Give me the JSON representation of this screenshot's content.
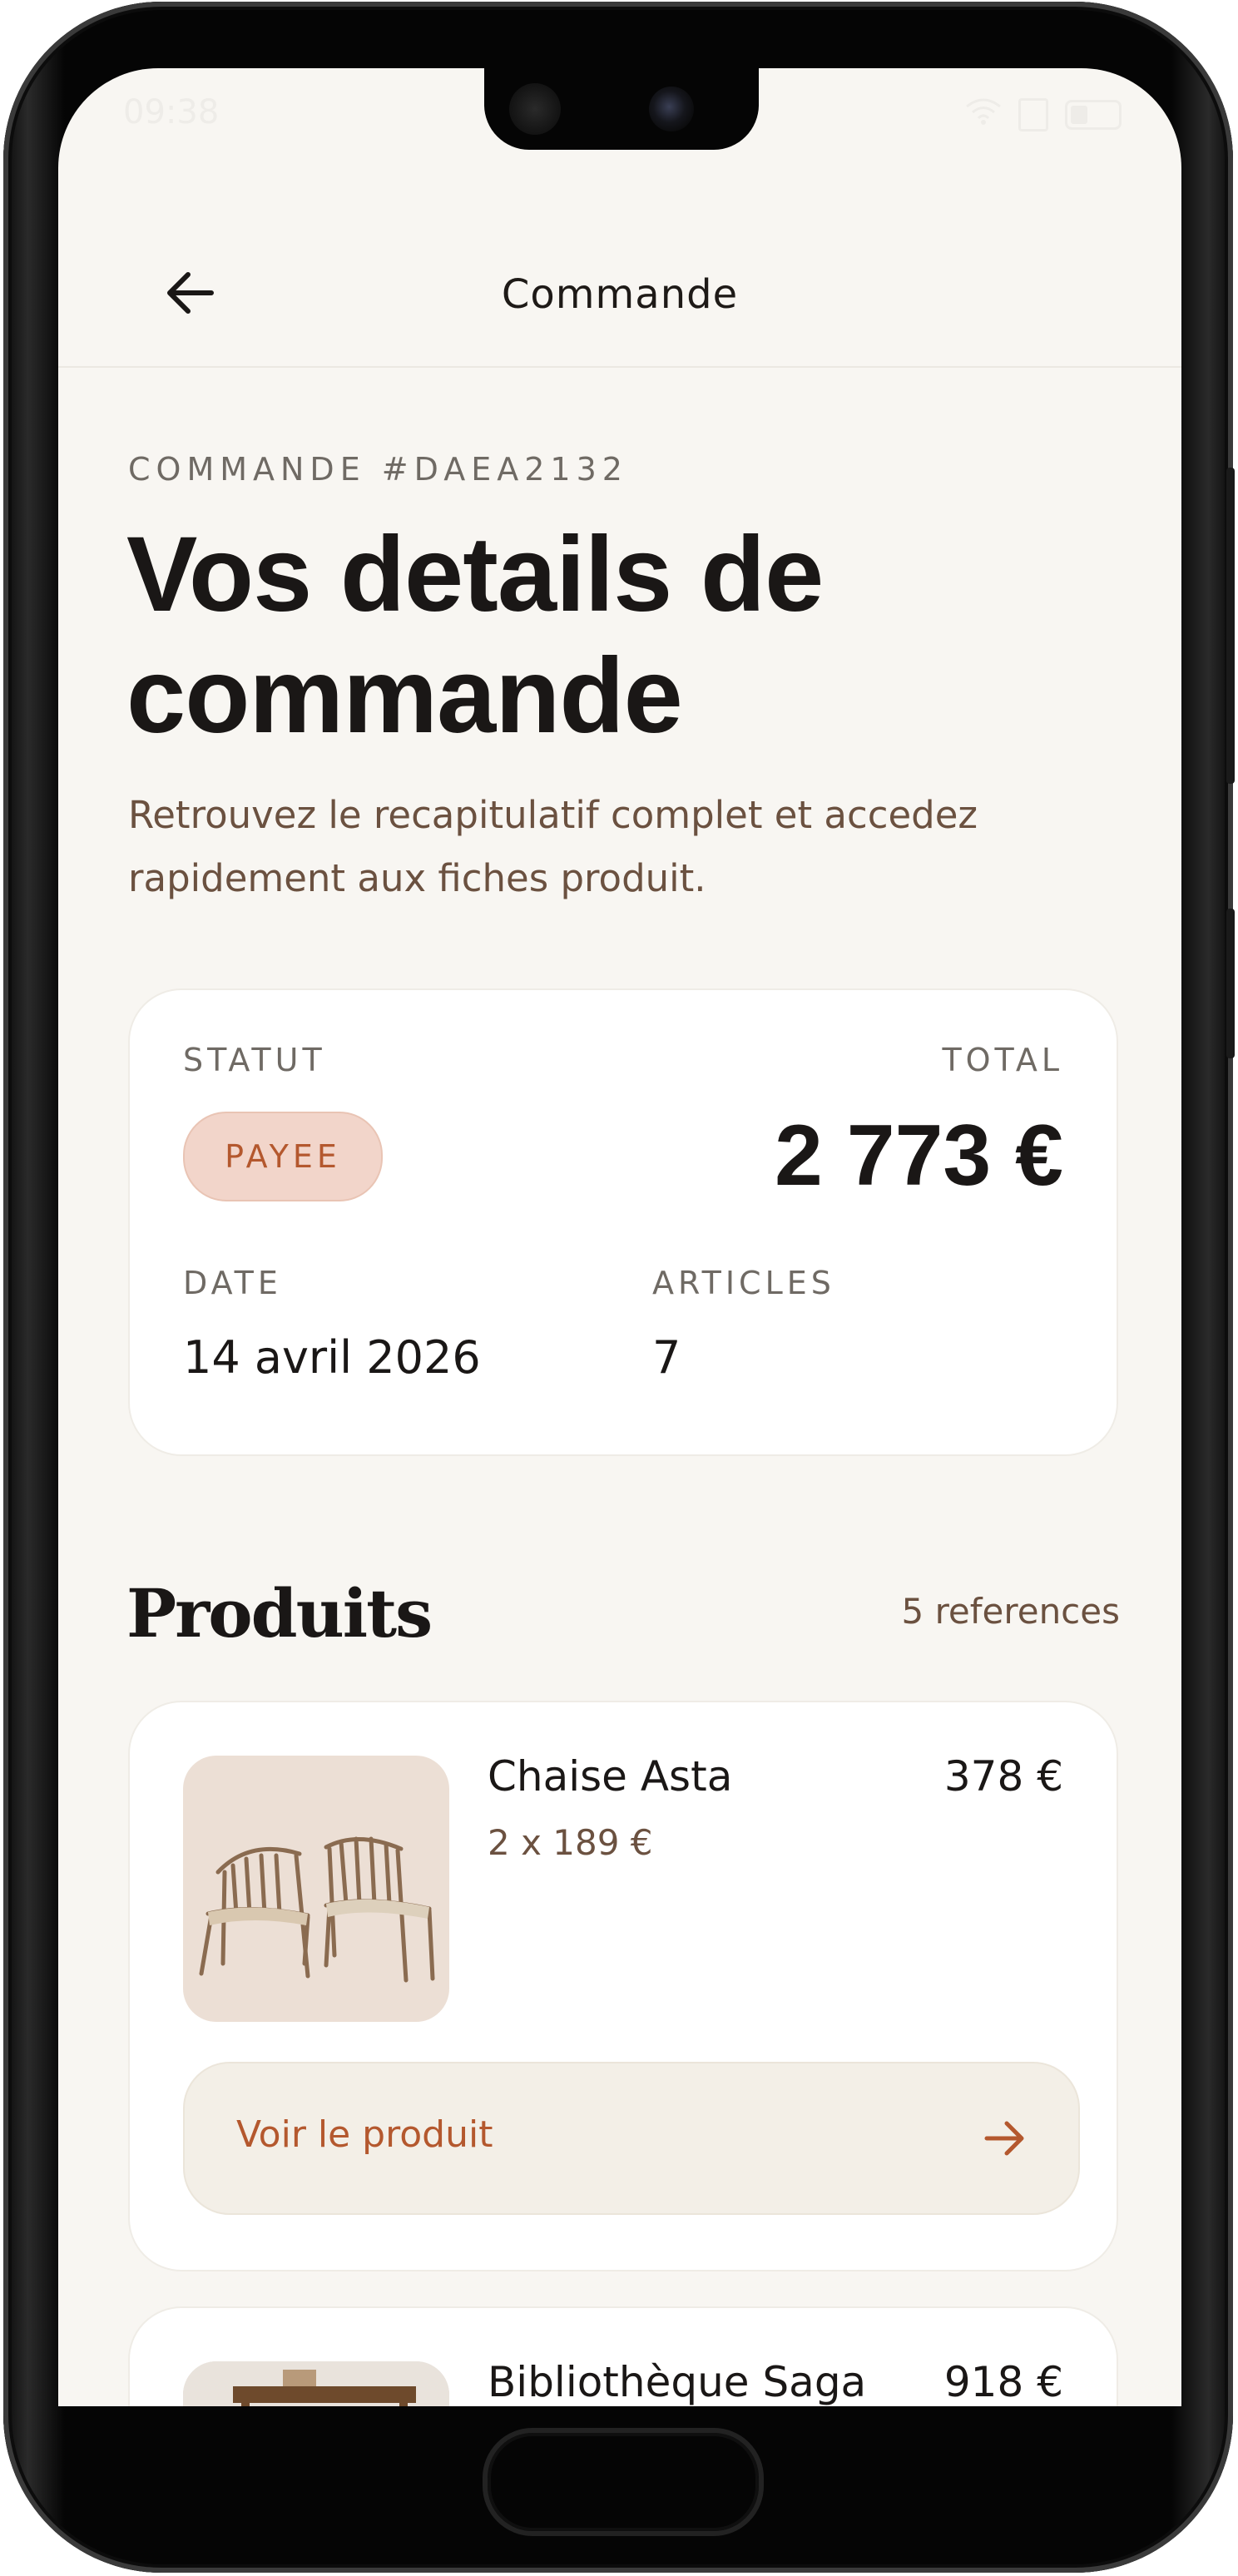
{
  "status_bar": {
    "time": "09:38"
  },
  "header": {
    "title": "Commande",
    "back_icon": "arrow-left-icon"
  },
  "order": {
    "eyebrow": "COMMANDE #DAEA2132",
    "title_line1": "Vos details de",
    "title_line2": "commande",
    "subtitle_line1": "Retrouvez le recapitulatif complet et accedez",
    "subtitle_line2": "rapidement aux fiches produit."
  },
  "summary": {
    "status_label": "STATUT",
    "status_value": "PAYEE",
    "total_label": "TOTAL",
    "total_value": "2 773 €",
    "date_label": "DATE",
    "date_value": "14 avril 2026",
    "articles_label": "ARTICLES",
    "articles_value": "7"
  },
  "products": {
    "title": "Produits",
    "count": "5 references",
    "items": [
      {
        "name": "Chaise Asta",
        "qty": "2 x 189 €",
        "price": "378 €",
        "cta": "Voir le produit",
        "image": "chairs-photo"
      },
      {
        "name": "Bibliothèque Saga",
        "price": "918 €",
        "image": "bookshelf-photo"
      }
    ]
  },
  "colors": {
    "accent": "#b4582e",
    "badge_bg": "#f2d5ca",
    "background": "#f8f6f2",
    "text": "#1a1716"
  }
}
